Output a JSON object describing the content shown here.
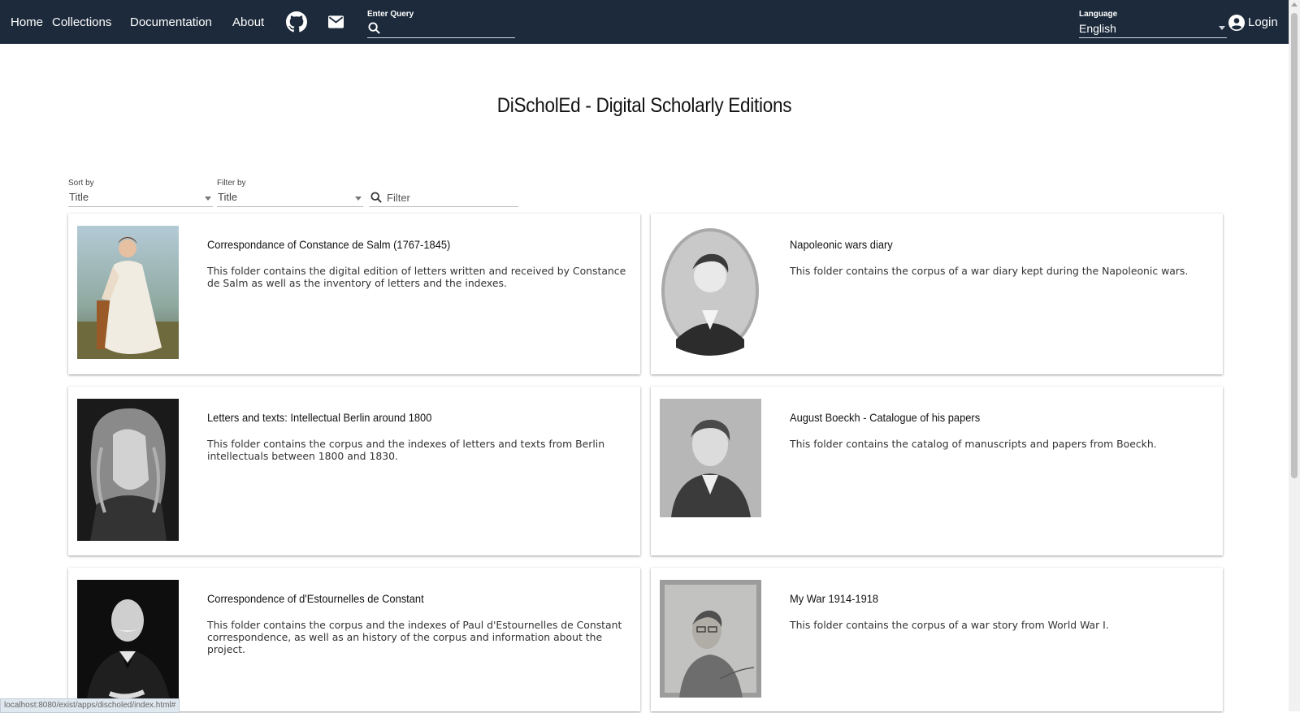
{
  "nav": {
    "home": "Home",
    "collections": "Collections",
    "documentation": "Documentation",
    "about": "About",
    "query_label": "Enter Query",
    "language_label": "Language",
    "language_value": "English",
    "login": "Login"
  },
  "page": {
    "title": "DiScholEd - Digital Scholarly Editions"
  },
  "controls": {
    "sort_label": "Sort by",
    "sort_value": "Title",
    "filter_label": "Filter by",
    "filter_value": "Title",
    "filter_placeholder": "Filter"
  },
  "cards": [
    {
      "title": "Correspondance of Constance de Salm (1767-1845)",
      "description": "This folder contains the digital edition of letters written and received by Constance de Salm as well as the inventory of letters and the indexes."
    },
    {
      "title": "Napoleonic wars diary",
      "description": "This folder contains the corpus of a war diary kept during the Napoleonic wars."
    },
    {
      "title": "Letters and texts: Intellectual Berlin around 1800",
      "description": "This folder contains the corpus and the indexes of letters and texts from Berlin intellectuals between 1800 and 1830."
    },
    {
      "title": "August Boeckh - Catalogue of his papers",
      "description": "This folder contains the catalog of manuscripts and papers from Boeckh."
    },
    {
      "title": "Correspondence of d'Estournelles de Constant",
      "description": "This folder contains the corpus and the indexes of Paul d'Estournelles de Constant correspondence, as well as an history of the corpus and information about the project."
    },
    {
      "title": "My War 1914-1918",
      "description": "This folder contains the corpus of a war story from World War I."
    }
  ],
  "statusbar": {
    "url": "localhost:8080/exist/apps/discholed/index.html#"
  },
  "colors": {
    "navbar": "#1c2a3b",
    "page_background": "#ffffff"
  },
  "icons": [
    "search-icon",
    "github-icon",
    "mail-icon",
    "account-circle-icon",
    "chevron-down-icon"
  ]
}
